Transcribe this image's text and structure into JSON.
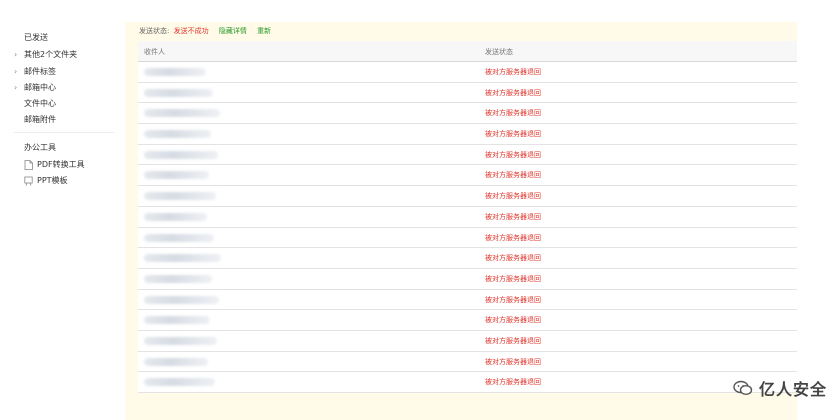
{
  "sidebar": {
    "items": [
      {
        "label": "已发送",
        "chevron": false
      },
      {
        "label": "其他2个文件夹",
        "chevron": true
      },
      {
        "label": "邮件标签",
        "chevron": true
      },
      {
        "label": "邮箱中心",
        "chevron": true
      },
      {
        "label": "文件中心",
        "chevron": false
      },
      {
        "label": "邮箱附件",
        "chevron": false
      }
    ],
    "section_title": "办公工具",
    "tools": [
      {
        "label": "PDF转换工具",
        "icon": "pdf-icon"
      },
      {
        "label": "PPT模板",
        "icon": "ppt-icon"
      }
    ]
  },
  "status_bar": {
    "label": "发送状态:",
    "fail_text": "发送不成功",
    "hide_details": "隐藏详情",
    "resend": "重新"
  },
  "table": {
    "headers": [
      "收件人",
      "发送状态"
    ],
    "rows": [
      {
        "status": "被对方服务器退回"
      },
      {
        "status": "被对方服务器退回"
      },
      {
        "status": "被对方服务器退回"
      },
      {
        "status": "被对方服务器退回"
      },
      {
        "status": "被对方服务器退回"
      },
      {
        "status": "被对方服务器退回"
      },
      {
        "status": "被对方服务器退回"
      },
      {
        "status": "被对方服务器退回"
      },
      {
        "status": "被对方服务器退回"
      },
      {
        "status": "被对方服务器退回"
      },
      {
        "status": "被对方服务器退回"
      },
      {
        "status": "被对方服务器退回"
      },
      {
        "status": "被对方服务器退回"
      },
      {
        "status": "被对方服务器退回"
      },
      {
        "status": "被对方服务器退回"
      },
      {
        "status": "被对方服务器退回"
      }
    ]
  },
  "watermark": {
    "text": "亿人安全"
  },
  "colors": {
    "fail": "#e0352b",
    "action": "#2a9a2a",
    "main_bg": "#fffbe8"
  }
}
